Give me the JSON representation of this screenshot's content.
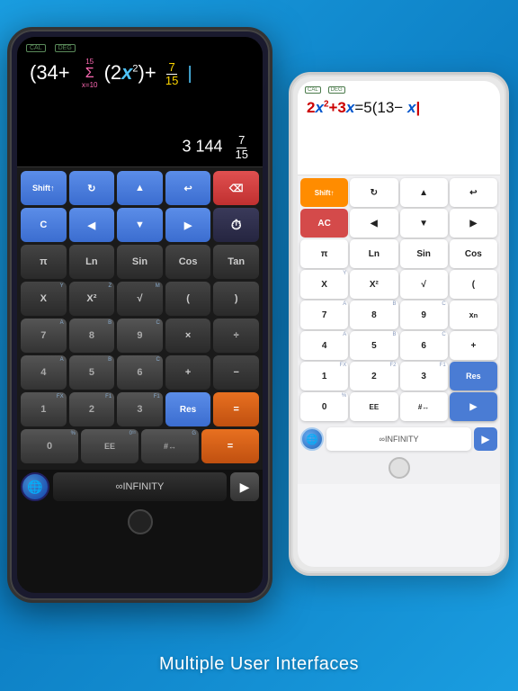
{
  "page": {
    "background": "#1a9de0",
    "subtitle": "Multiple User Interfaces"
  },
  "dark_tablet": {
    "labels": {
      "cal": "CAL",
      "deg": "DEG"
    },
    "display": {
      "expression": "(34+ Σ(2x²)+ 7/15",
      "result": "3 144 7/15"
    },
    "rows": [
      [
        {
          "label": "Shift↑",
          "style": "blue",
          "small": ""
        },
        {
          "label": "↻",
          "style": "blue",
          "small": ""
        },
        {
          "label": "▲",
          "style": "blue",
          "small": ""
        },
        {
          "label": "↩",
          "style": "blue",
          "small": ""
        },
        {
          "label": "⌫",
          "style": "red",
          "small": ""
        }
      ],
      [
        {
          "label": "C",
          "style": "blue",
          "small": ""
        },
        {
          "label": "◀",
          "style": "blue",
          "small": ""
        },
        {
          "label": "▼",
          "style": "blue",
          "small": ""
        },
        {
          "label": "▶",
          "style": "blue",
          "small": ""
        },
        {
          "label": "🕐",
          "style": "med",
          "small": ""
        }
      ],
      [
        {
          "label": "π",
          "style": "dark",
          "small": ""
        },
        {
          "label": "Ln",
          "style": "dark",
          "small": ""
        },
        {
          "label": "Sin",
          "style": "dark",
          "small": ""
        },
        {
          "label": "Cos",
          "style": "dark",
          "small": ""
        },
        {
          "label": "Tan",
          "style": "dark",
          "small": ""
        }
      ],
      [
        {
          "label": "X",
          "style": "dark",
          "small": "Y"
        },
        {
          "label": "X²",
          "style": "dark",
          "small": "Z"
        },
        {
          "label": "√",
          "style": "dark",
          "small": "M"
        },
        {
          "label": "(",
          "style": "dark",
          "small": ""
        },
        {
          "label": ")",
          "style": "dark",
          "small": ""
        }
      ],
      [
        {
          "label": "7",
          "style": "gray",
          "small": "A"
        },
        {
          "label": "8",
          "style": "gray",
          "small": "B"
        },
        {
          "label": "9",
          "style": "gray",
          "small": "C"
        },
        {
          "label": "×",
          "style": "dark",
          "small": ""
        },
        {
          "label": "÷",
          "style": "dark",
          "small": ""
        }
      ],
      [
        {
          "label": "4",
          "style": "gray",
          "small": "A"
        },
        {
          "label": "5",
          "style": "gray",
          "small": "B"
        },
        {
          "label": "6",
          "style": "gray",
          "small": "C"
        },
        {
          "label": "+",
          "style": "dark",
          "small": ""
        },
        {
          "label": "−",
          "style": "dark",
          "small": ""
        }
      ],
      [
        {
          "label": "1",
          "style": "gray",
          "small": "FX"
        },
        {
          "label": "2",
          "style": "gray",
          "small": "F1"
        },
        {
          "label": "3",
          "style": "gray",
          "small": "F1"
        },
        {
          "label": "Res",
          "style": "blue",
          "small": ""
        },
        {
          "label": "=",
          "style": "orange",
          "small": ""
        }
      ],
      [
        {
          "label": "0",
          "style": "gray",
          "small": "%"
        },
        {
          "label": "EE",
          "style": "gray",
          "small": "0¹¹"
        },
        {
          "label": "#↔",
          "style": "gray",
          "small": "G"
        },
        {
          "label": "=",
          "style": "orange",
          "small": ""
        }
      ]
    ],
    "bottom": {
      "infinity_label": "∞INFINITY",
      "arrow": "▶"
    }
  },
  "white_tablet": {
    "labels": {
      "cal": "CAL",
      "deg": "DEG"
    },
    "display": {
      "expression": "2x²+3x=5(13−x▌"
    },
    "rows": [
      [
        {
          "label": "Shift↑",
          "style": "orange",
          "small": ""
        },
        {
          "label": "↻",
          "style": "white",
          "small": ""
        },
        {
          "label": "▲",
          "style": "white",
          "small": ""
        },
        {
          "label": "↩",
          "style": "white",
          "small": ""
        }
      ],
      [
        {
          "label": "AC",
          "style": "red",
          "small": ""
        },
        {
          "label": "◀",
          "style": "white",
          "small": ""
        },
        {
          "label": "▼",
          "style": "white",
          "small": ""
        },
        {
          "label": "▶",
          "style": "white",
          "small": ""
        }
      ],
      [
        {
          "label": "π",
          "style": "white",
          "small": ""
        },
        {
          "label": "Ln",
          "style": "white",
          "small": ""
        },
        {
          "label": "Sin",
          "style": "white",
          "small": ""
        },
        {
          "label": "Cos",
          "style": "white",
          "small": ""
        }
      ],
      [
        {
          "label": "X",
          "style": "white",
          "small": "Y"
        },
        {
          "label": "X²",
          "style": "white",
          "small": "Z"
        },
        {
          "label": "√",
          "style": "white",
          "small": "M"
        },
        {
          "label": "(",
          "style": "white",
          "small": ""
        }
      ],
      [
        {
          "label": "7",
          "style": "white",
          "small": "A"
        },
        {
          "label": "8",
          "style": "white",
          "small": "B"
        },
        {
          "label": "9",
          "style": "white",
          "small": "C"
        },
        {
          "label": "xⁿ",
          "style": "white",
          "small": ""
        }
      ],
      [
        {
          "label": "4",
          "style": "white",
          "small": "A"
        },
        {
          "label": "5",
          "style": "white",
          "small": "B"
        },
        {
          "label": "6",
          "style": "white",
          "small": "C"
        },
        {
          "label": "+",
          "style": "white",
          "small": ""
        }
      ],
      [
        {
          "label": "1",
          "style": "white",
          "small": "FX"
        },
        {
          "label": "2",
          "style": "white",
          "small": "F2"
        },
        {
          "label": "3",
          "style": "white",
          "small": "F1"
        },
        {
          "label": "Res",
          "style": "blue",
          "small": ""
        }
      ],
      [
        {
          "label": "0",
          "style": "white",
          "small": "%"
        },
        {
          "label": "EE",
          "style": "white",
          "small": "0¹¹"
        },
        {
          "label": "#↔",
          "style": "white",
          "small": "G"
        },
        {
          "label": "▶",
          "style": "blue",
          "small": ""
        }
      ]
    ],
    "bottom": {
      "infinity_label": "∞INFINITY",
      "arrow": "▶"
    }
  }
}
